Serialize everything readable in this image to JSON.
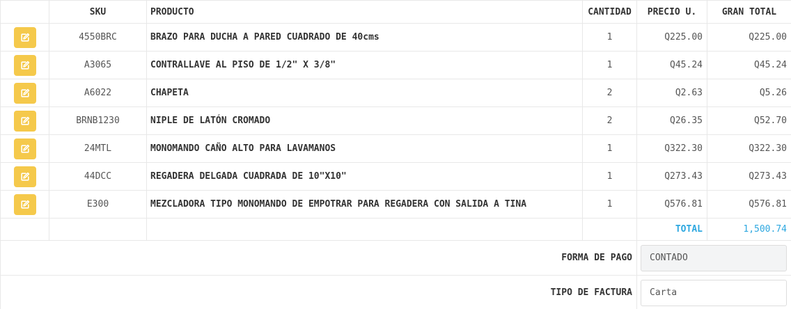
{
  "table": {
    "headers": {
      "action": "",
      "sku": "SKU",
      "product": "PRODUCTO",
      "quantity": "CANTIDAD",
      "unit_price": "PRECIO U.",
      "grand_total": "GRAN TOTAL"
    },
    "rows": [
      {
        "sku": "4550BRC",
        "product": "BRAZO PARA DUCHA A PARED CUADRADO DE 40cms",
        "quantity": "1",
        "unit_price": "Q225.00",
        "total": "Q225.00"
      },
      {
        "sku": "A3065",
        "product": "CONTRALLAVE AL PISO DE 1/2\" X 3/8\"",
        "quantity": "1",
        "unit_price": "Q45.24",
        "total": "Q45.24"
      },
      {
        "sku": "A6022",
        "product": "CHAPETA",
        "quantity": "2",
        "unit_price": "Q2.63",
        "total": "Q5.26"
      },
      {
        "sku": "BRNB1230",
        "product": "NIPLE DE LATÓN CROMADO",
        "quantity": "2",
        "unit_price": "Q26.35",
        "total": "Q52.70"
      },
      {
        "sku": "24MTL",
        "product": "MONOMANDO CAÑO ALTO PARA LAVAMANOS",
        "quantity": "1",
        "unit_price": "Q322.30",
        "total": "Q322.30"
      },
      {
        "sku": "44DCC",
        "product": "REGADERA DELGADA CUADRADA DE 10\"X10\"",
        "quantity": "1",
        "unit_price": "Q273.43",
        "total": "Q273.43"
      },
      {
        "sku": "E300",
        "product": "MEZCLADORA TIPO MONOMANDO DE EMPOTRAR PARA REGADERA CON SALIDA A TINA",
        "quantity": "1",
        "unit_price": "Q576.81",
        "total": "Q576.81"
      }
    ],
    "edit_icon": "edit-icon"
  },
  "summary": {
    "total_label": "TOTAL",
    "total_value": "1,500.74"
  },
  "form": {
    "payment_label": "FORMA DE PAGO",
    "payment_value": "CONTADO",
    "invoice_label": "TIPO DE FACTURA",
    "invoice_value": "Carta"
  },
  "colors": {
    "edit_button": "#f5c94b",
    "total_accent": "#2ea8e0",
    "border": "#e8e8e8"
  }
}
